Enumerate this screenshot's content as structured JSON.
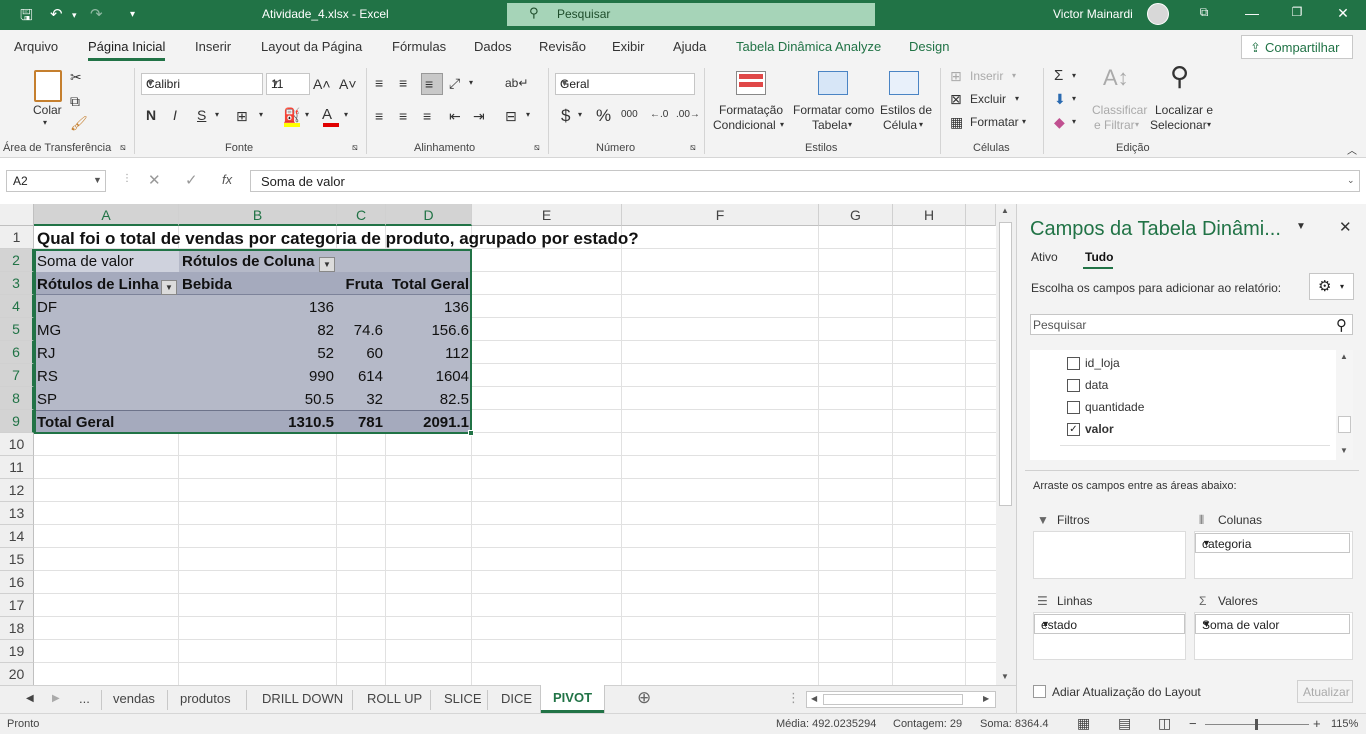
{
  "titlebar": {
    "file_title": "Atividade_4.xlsx  -  Excel",
    "search_placeholder": "Pesquisar",
    "user_name": "Victor Mainardi"
  },
  "menu": {
    "tabs": [
      "Arquivo",
      "Página Inicial",
      "Inserir",
      "Layout da Página",
      "Fórmulas",
      "Dados",
      "Revisão",
      "Exibir",
      "Ajuda",
      "Tabela Dinâmica Analyze",
      "Design"
    ],
    "active": "Página Inicial",
    "share_label": "Compartilhar"
  },
  "ribbon": {
    "clipboard": {
      "paste_label": "Colar",
      "group_label": "Área de Transferência"
    },
    "font": {
      "family": "Calibri",
      "size": "11",
      "bold": "N",
      "italic": "I",
      "underline": "S",
      "group_label": "Fonte"
    },
    "alignment": {
      "group_label": "Alinhamento"
    },
    "number": {
      "format": "Geral",
      "currency": "$",
      "percent": "%",
      "thousands": "000",
      "group_label": "Número"
    },
    "styles": {
      "conditional_line1": "Formatação",
      "conditional_line2": "Condicional",
      "table_line1": "Formatar como",
      "table_line2": "Tabela",
      "cell_line1": "Estilos de",
      "cell_line2": "Célula",
      "group_label": "Estilos"
    },
    "cells": {
      "insert": "Inserir",
      "delete": "Excluir",
      "format": "Formatar",
      "group_label": "Células"
    },
    "editing": {
      "sort_line1": "Classificar",
      "sort_line2": "e Filtrar",
      "find_line1": "Localizar e",
      "find_line2": "Selecionar",
      "group_label": "Edição"
    }
  },
  "formula_bar": {
    "name_box": "A2",
    "fx": "fx",
    "content": "Soma de valor"
  },
  "grid": {
    "columns": [
      "A",
      "B",
      "C",
      "D",
      "E",
      "F",
      "G",
      "H"
    ],
    "rows": [
      "1",
      "2",
      "3",
      "4",
      "5",
      "6",
      "7",
      "8",
      "9",
      "10",
      "11",
      "12",
      "13",
      "14",
      "15",
      "16",
      "17",
      "18",
      "19",
      "20"
    ],
    "title": "Qual foi o total de vendas por categoria de produto, agrupado por estado?",
    "pivot": {
      "values_label": "Soma de valor",
      "col_labels": "Rótulos de Coluna",
      "row_labels": "Rótulos de Linha",
      "col_headers": [
        "Bebida",
        "Fruta",
        "Total Geral"
      ],
      "rows": [
        {
          "state": "DF",
          "bebida": "136",
          "fruta": "",
          "total": "136"
        },
        {
          "state": "MG",
          "bebida": "82",
          "fruta": "74.6",
          "total": "156.6"
        },
        {
          "state": "RJ",
          "bebida": "52",
          "fruta": "60",
          "total": "112"
        },
        {
          "state": "RS",
          "bebida": "990",
          "fruta": "614",
          "total": "1604"
        },
        {
          "state": "SP",
          "bebida": "50.5",
          "fruta": "32",
          "total": "82.5"
        }
      ],
      "grand_total": {
        "label": "Total Geral",
        "bebida": "1310.5",
        "fruta": "781",
        "total": "2091.1"
      }
    }
  },
  "sheets": {
    "tabs": [
      "...",
      "vendas",
      "produtos",
      "DRILL DOWN",
      "ROLL UP",
      "SLICE",
      "DICE",
      "PIVOT"
    ],
    "active": "PIVOT"
  },
  "status": {
    "mode": "Pronto",
    "average": "Média: 492.0235294",
    "count": "Contagem: 29",
    "sum": "Soma: 8364.4",
    "zoom": "115%"
  },
  "pivot_pane": {
    "title": "Campos da Tabela Dinâmi...",
    "tab_active": "Ativo",
    "tab_all": "Tudo",
    "choose_label": "Escolha os campos para adicionar ao relatório:",
    "search_placeholder": "Pesquisar",
    "fields": [
      {
        "name": "id_loja",
        "checked": false
      },
      {
        "name": "data",
        "checked": false
      },
      {
        "name": "quantidade",
        "checked": false
      },
      {
        "name": "valor",
        "checked": true
      }
    ],
    "drag_label": "Arraste os campos entre as áreas abaixo:",
    "filters_label": "Filtros",
    "columns_label": "Colunas",
    "columns_item": "categoria",
    "rows_label": "Linhas",
    "rows_item": "estado",
    "values_label": "Valores",
    "values_item": "Soma de valor",
    "defer_label": "Adiar Atualização do Layout",
    "update_label": "Atualizar"
  },
  "colors": {
    "excel_green": "#217346",
    "pivot_body": "#b5b9c8",
    "pivot_header": "#a5aabd"
  }
}
